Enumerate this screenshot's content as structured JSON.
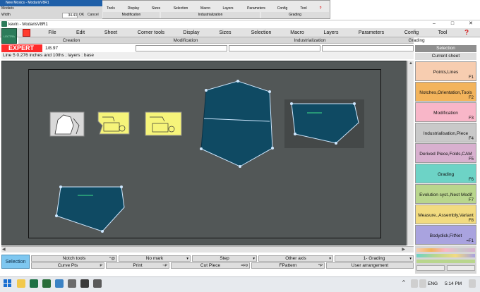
{
  "background_window": {
    "title": "New Mosics - ModarisV8R1",
    "side_labels": [
      "Modaris",
      "Width",
      "34.43",
      "OK",
      "Cancel"
    ],
    "menu": [
      "Tools",
      "Display",
      "Sizes",
      "Selection",
      "Macro",
      "Layers",
      "Parameters",
      "Config",
      "Tool",
      "?"
    ],
    "sub_menu": [
      "Modification",
      "Industrialization",
      "Grading"
    ]
  },
  "window": {
    "title": "kevin - ModarisV8R1",
    "minimize": "–",
    "maximize": "□",
    "close": "✕"
  },
  "menubar": {
    "items": [
      "File",
      "Edit",
      "Sheet",
      "Corner tools",
      "Display",
      "Sizes",
      "Selection",
      "Macro",
      "Layers",
      "Parameters",
      "Config",
      "Tool"
    ],
    "help": "?"
  },
  "subbar": {
    "items": [
      "Creation",
      "Modification",
      "Industrialization",
      "Grading"
    ]
  },
  "logo": "LECTRA",
  "expert_label": "EXPERT",
  "version_label": "1/8.97",
  "status_line": "Line 5 0.276 inches and 10ths ;   layers : base",
  "right_panel": {
    "header1": "Selection",
    "header2": "Current sheet",
    "buttons": [
      {
        "label": "Points,Lines",
        "key": "F1",
        "color": "#f7cdb0"
      },
      {
        "label": "Notches,Orientation,Tools",
        "key": "F2",
        "color": "#f3b45c"
      },
      {
        "label": "Modification",
        "key": "F3",
        "color": "#f8b6c8"
      },
      {
        "label": "Industrialisation,Piece",
        "key": "F4",
        "color": "#c9c9c9"
      },
      {
        "label": "Derived Piece,Folds,CAM",
        "key": "F5",
        "color": "#d8b0cf"
      },
      {
        "label": "Grading",
        "key": "F6",
        "color": "#6dd3c6"
      },
      {
        "label": "Evolution syst.,Nest Modif",
        "key": "F7",
        "color": "#b9d68d"
      },
      {
        "label": "Measure.,Assembly,Variant",
        "key": "F8",
        "color": "#f2db80"
      },
      {
        "label": "Bodydick,FitNet",
        "key": "=F1",
        "color": "#a9a3df"
      }
    ]
  },
  "bottom_toolbar": {
    "selection_button": "Selection",
    "row1": [
      {
        "label": "Notch tools",
        "key": "^@"
      },
      {
        "label": "No mark",
        "key": ""
      },
      {
        "label": "Step",
        "key": ""
      },
      {
        "label": "Other axis",
        "key": ""
      },
      {
        "label": "1- Grading",
        "key": ""
      }
    ],
    "row2": [
      {
        "label": "Curve Pts",
        "key": "P"
      },
      {
        "label": "Print",
        "key": "~P"
      },
      {
        "label": "Cut Piece",
        "key": "=F9"
      },
      {
        "label": "FPattern",
        "key": "^P"
      },
      {
        "label": "User arrangement",
        "key": ""
      }
    ]
  },
  "taskbar": {
    "language": "ENG",
    "time": "5:14 PM"
  },
  "colors": {
    "piece_fill": "#0f4a63",
    "piece_outline": "#cfe8ff",
    "canvas_bg": "#525757",
    "selection_bg": "#444848"
  }
}
